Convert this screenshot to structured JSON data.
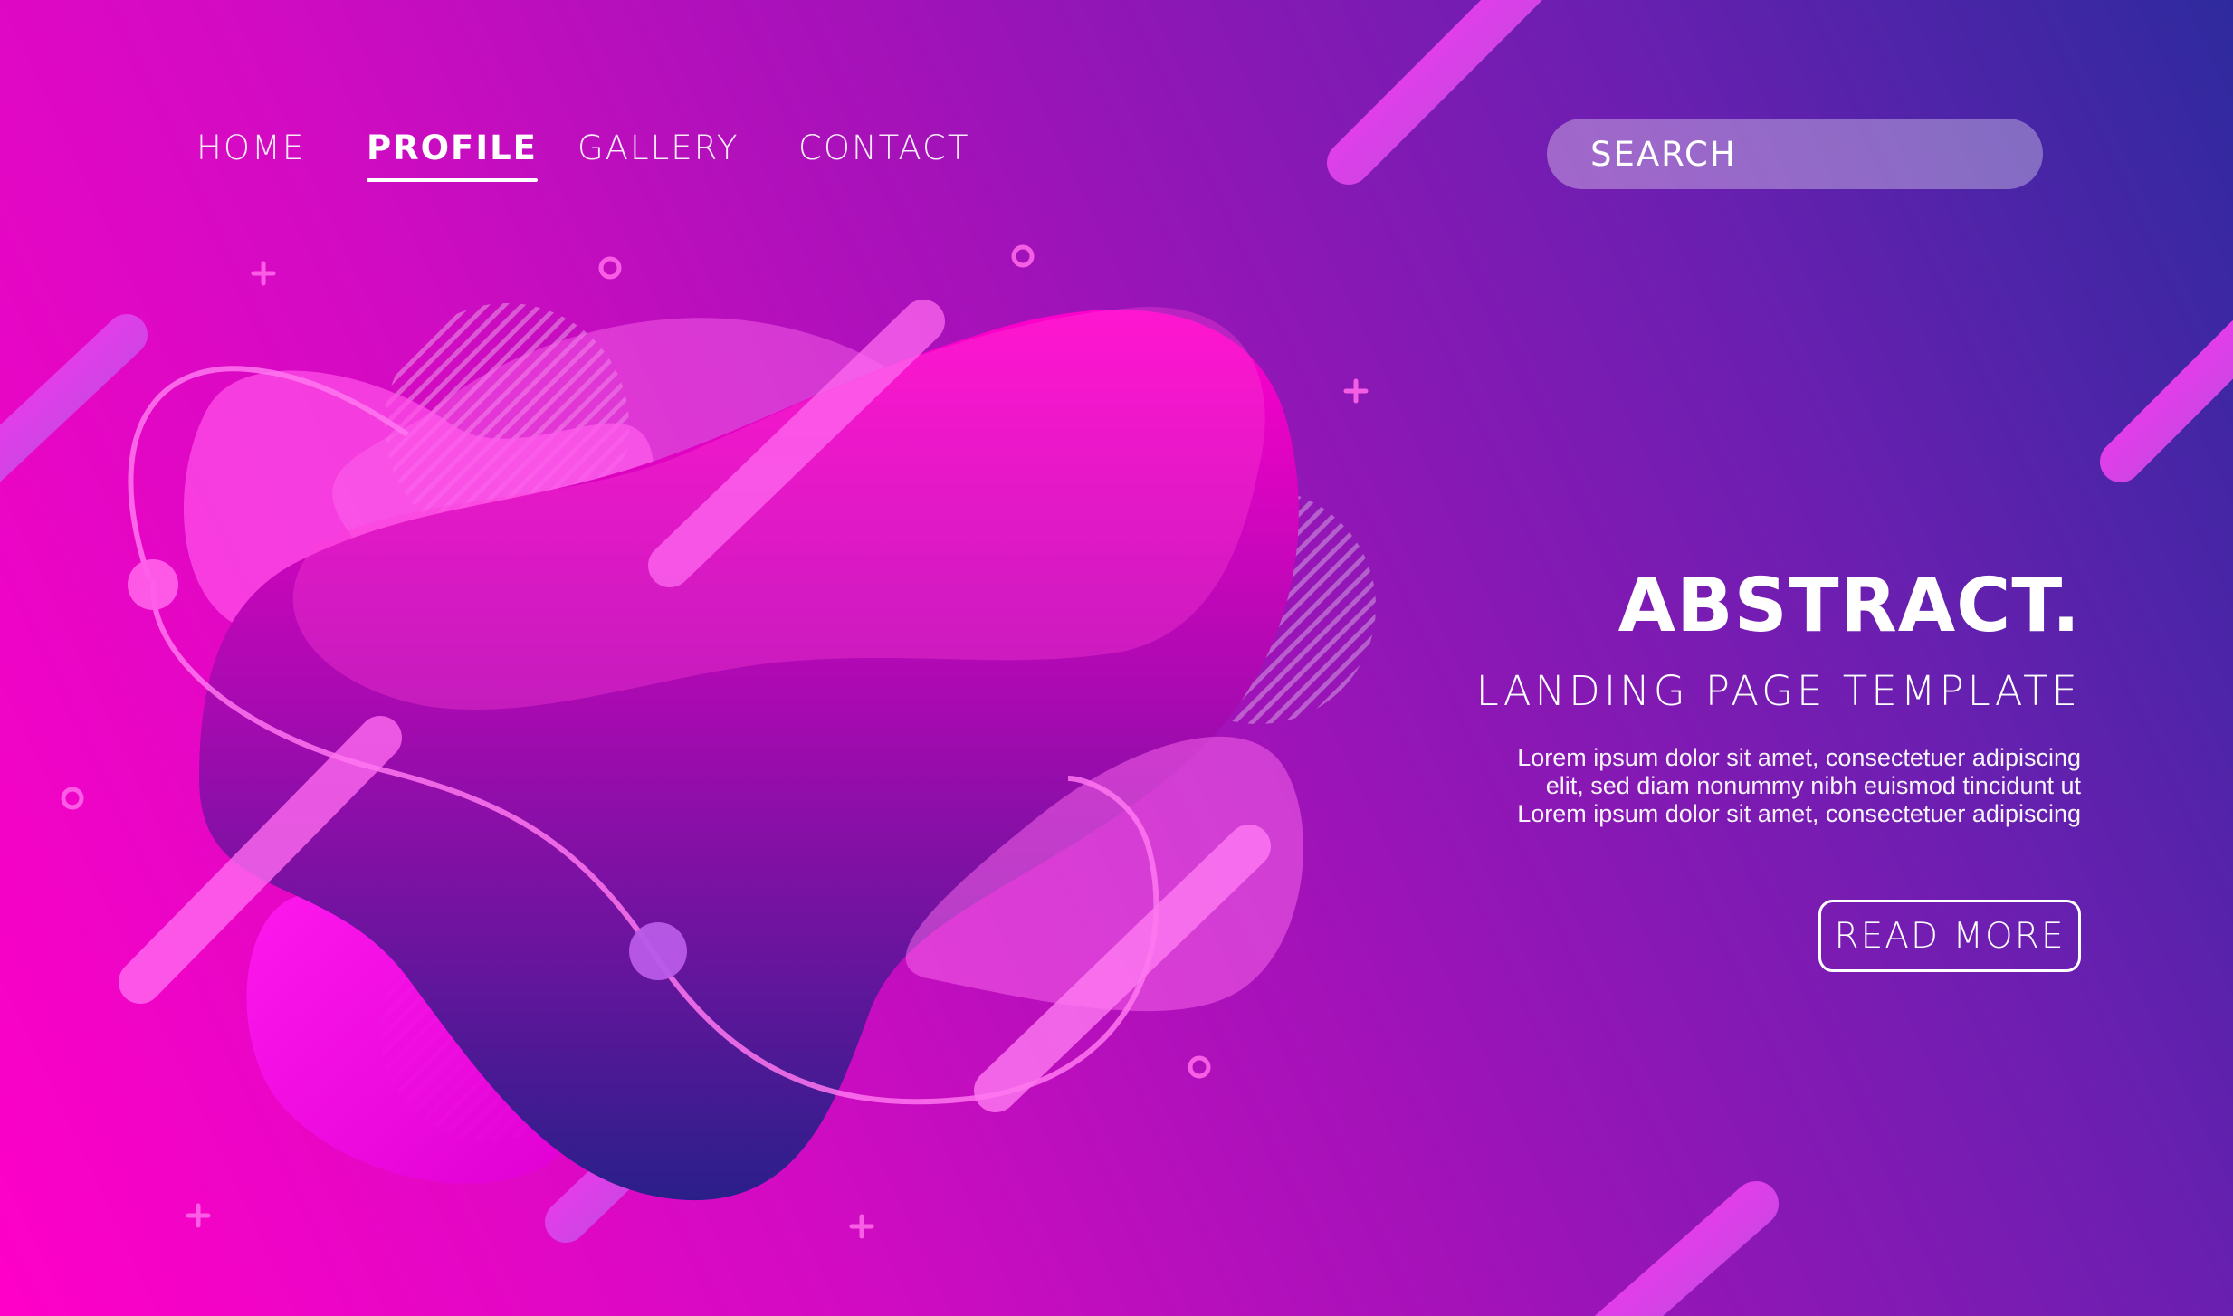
{
  "nav": {
    "items": [
      {
        "label": "HOME",
        "active": false
      },
      {
        "label": "PROFILE",
        "active": true
      },
      {
        "label": "GALLERY",
        "active": false
      },
      {
        "label": "CONTACT",
        "active": false
      }
    ]
  },
  "search": {
    "placeholder": "SEARCH"
  },
  "hero": {
    "title": "ABSTRACT.",
    "subtitle": "LANDING PAGE TEMPLATE",
    "body_lines": [
      "Lorem ipsum dolor sit amet, consectetuer adipiscing",
      "elit, sed diam nonummy nibh euismod tincidunt ut",
      "Lorem ipsum dolor sit amet, consectetuer adipiscing"
    ],
    "cta_label": "READ MORE"
  },
  "colors": {
    "background_start": "#2e2a9e",
    "background_end": "#ff00c8",
    "blob_magenta": "#ff00cc",
    "blob_deep": "#2a1f8a",
    "text": "#ffffff"
  }
}
